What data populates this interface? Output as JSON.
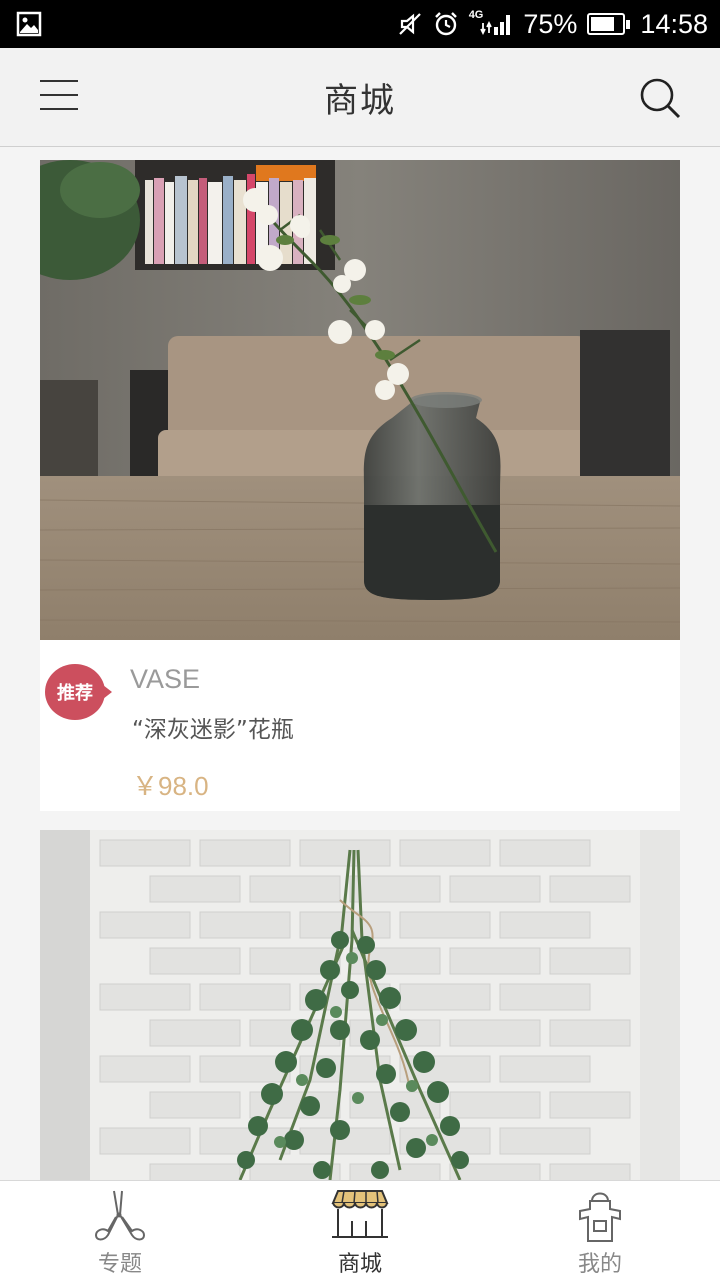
{
  "status_bar": {
    "network": "4G",
    "battery": "75%",
    "battery_level": 0.75,
    "time": "14:58",
    "icons": [
      "image-icon",
      "mute-icon",
      "alarm-icon",
      "signal-icon",
      "battery-icon"
    ]
  },
  "header": {
    "title": "商城",
    "icons": [
      "menu-icon",
      "search-icon"
    ]
  },
  "products": [
    {
      "badge": "推荐",
      "category": "VASE",
      "name": "“深灰迷影”花瓶",
      "price": "￥98.0"
    }
  ],
  "bottom_nav": {
    "active": 1,
    "items": [
      {
        "label": "专题",
        "icon": "pruning-shears-icon"
      },
      {
        "label": "商城",
        "icon": "shop-awning-icon"
      },
      {
        "label": "我的",
        "icon": "apron-icon"
      }
    ]
  },
  "colors": {
    "badge": "#cc4f5e",
    "price": "#d8b483",
    "awning": "#e3c27a",
    "header_bg": "#f2f2f2"
  }
}
